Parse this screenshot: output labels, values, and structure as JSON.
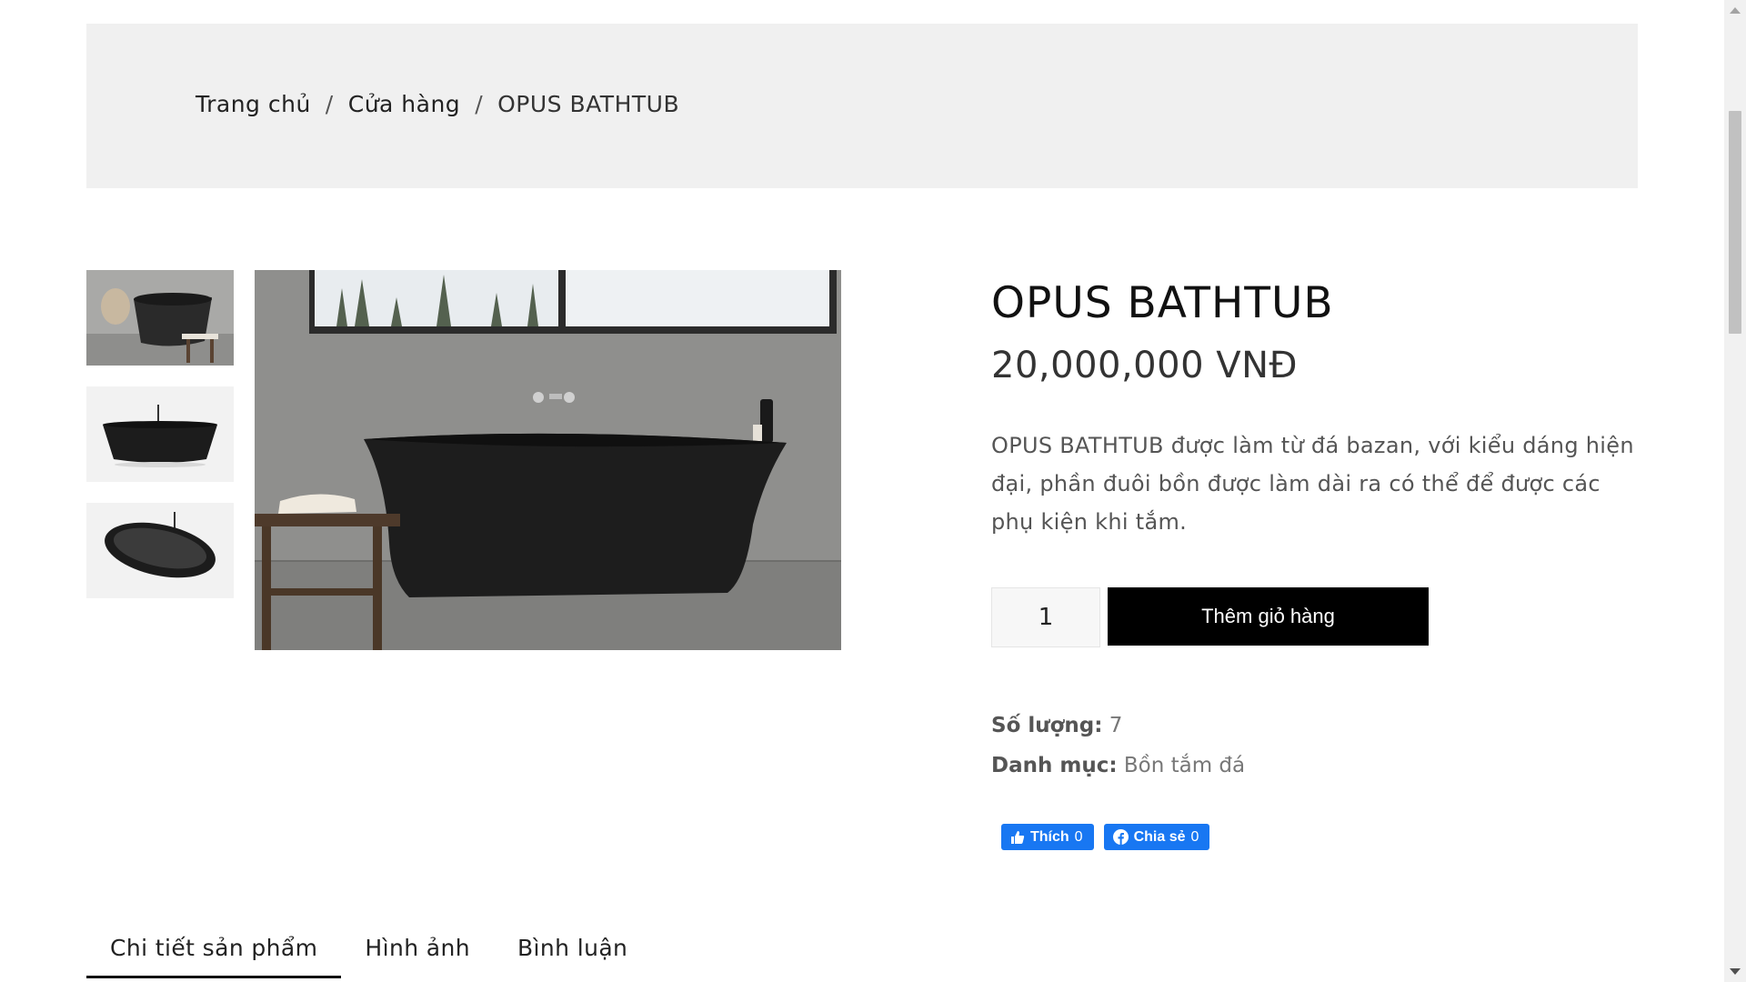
{
  "breadcrumb": {
    "home": "Trang chủ",
    "shop": "Cửa hàng",
    "current": "OPUS BATHTUB",
    "separator": "/"
  },
  "product": {
    "title": "OPUS BATHTUB",
    "price": "20,000,000 VNĐ",
    "description": "OPUS BATHTUB được làm từ đá bazan, với kiểu dáng hiện đại, phần đuôi bồn được làm dài ra có thể để được các phụ kiện khi tắm.",
    "quantity_value": "1",
    "add_to_cart_label": "Thêm giỏ hàng",
    "stock_label": "Số lượng:",
    "stock_value": "7",
    "category_label": "Danh mục:",
    "category_value": "Bồn tắm đá"
  },
  "social": {
    "like_label": "Thích",
    "like_count": "0",
    "share_label": "Chia sẻ",
    "share_count": "0"
  },
  "tabs": [
    {
      "label": "Chi tiết sản phẩm",
      "active": true
    },
    {
      "label": "Hình ảnh",
      "active": false
    },
    {
      "label": "Bình luận",
      "active": false
    }
  ],
  "colors": {
    "band": "#f0f0f0",
    "button": "#000000",
    "facebook": "#1877f2"
  }
}
